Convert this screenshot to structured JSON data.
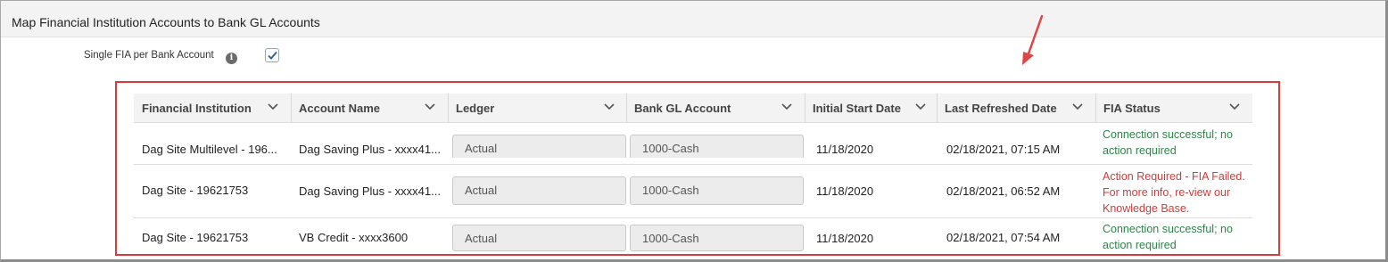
{
  "page": {
    "title": "Map Financial Institution Accounts to Bank GL Accounts"
  },
  "option": {
    "label": "Single FIA per Bank Account",
    "checked": true
  },
  "columns": [
    "Financial Institution",
    "Account Name",
    "Ledger",
    "Bank GL Account",
    "Initial Start Date",
    "Last Refreshed Date",
    "FIA Status"
  ],
  "rows": [
    {
      "institution": "Dag Site Multilevel - 196...",
      "account": "Dag Saving Plus - xxxx41...",
      "ledger": "Actual",
      "gl_account": "1000-Cash",
      "start_date": "11/18/2020",
      "refreshed": "02/18/2021, 07:15 AM",
      "status": "Connection successful; no action required",
      "status_kind": "ok"
    },
    {
      "institution": "Dag Site - 19621753",
      "account": "Dag Saving Plus - xxxx41...",
      "ledger": "Actual",
      "gl_account": "1000-Cash",
      "start_date": "11/18/2020",
      "refreshed": "02/18/2021, 06:52 AM",
      "status": "Action Required - FIA Failed. For more info, re-view our Knowledge Base.",
      "status_kind": "error"
    },
    {
      "institution": "Dag Site - 19621753",
      "account": "VB Credit - xxxx3600",
      "ledger": "Actual",
      "gl_account": "1000-Cash",
      "start_date": "11/18/2020",
      "refreshed": "02/18/2021, 07:54 AM",
      "status": "Connection successful; no action required",
      "status_kind": "ok"
    }
  ],
  "colors": {
    "ok": "#2e844a",
    "error": "#d23b3b",
    "highlight_border": "#d93a3a",
    "checkbox_accent": "#1b5fa8"
  },
  "icons": {
    "info": "info-icon",
    "sort": "chevron-down-icon",
    "check": "checkmark-icon",
    "annotation": "red-arrow-annotation"
  }
}
